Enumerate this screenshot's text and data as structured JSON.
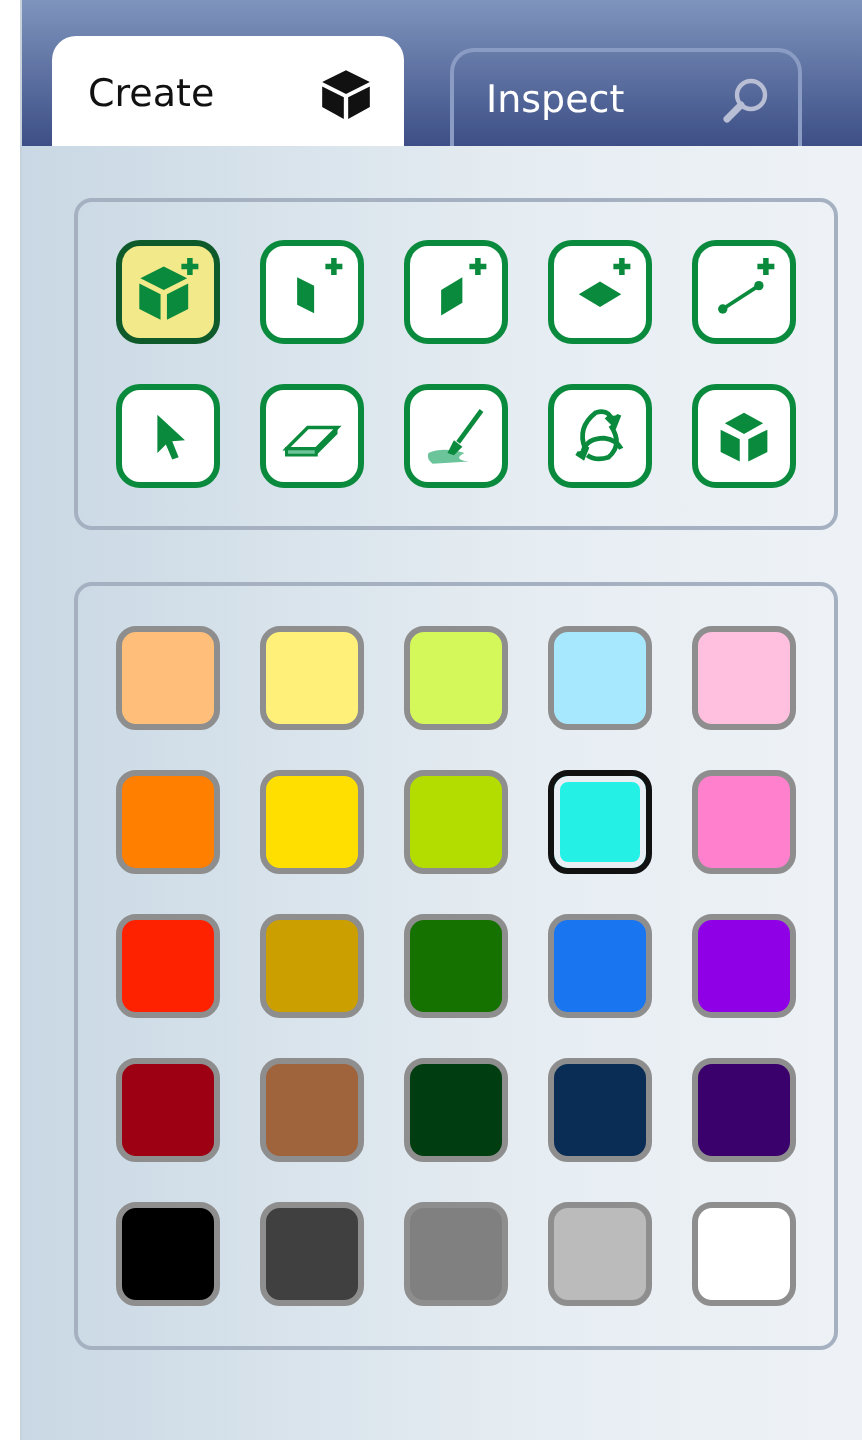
{
  "tabs": [
    {
      "label": "Create",
      "selected": true,
      "kind": "cube"
    },
    {
      "label": "Inspect",
      "selected": false,
      "kind": "search"
    }
  ],
  "tools": [
    {
      "kind": "solid",
      "selected": true
    },
    {
      "kind": "wall",
      "selected": false
    },
    {
      "kind": "slope",
      "selected": false
    },
    {
      "kind": "floor",
      "selected": false
    },
    {
      "kind": "edge",
      "selected": false
    },
    {
      "kind": "pointer",
      "selected": false
    },
    {
      "kind": "eraser",
      "selected": false
    },
    {
      "kind": "paint",
      "selected": false
    },
    {
      "kind": "rotate",
      "selected": false
    },
    {
      "kind": "box",
      "selected": false
    }
  ],
  "swatches": [
    {
      "color": "#ffbf7a",
      "selected": false
    },
    {
      "color": "#fff07a",
      "selected": false
    },
    {
      "color": "#d4f75a",
      "selected": false
    },
    {
      "color": "#a8e8ff",
      "selected": false
    },
    {
      "color": "#ffbfdf",
      "selected": false
    },
    {
      "color": "#ff7f00",
      "selected": false
    },
    {
      "color": "#ffdf00",
      "selected": false
    },
    {
      "color": "#b3dd00",
      "selected": false
    },
    {
      "color": "#25f0e6",
      "selected": true
    },
    {
      "color": "#ff80cc",
      "selected": false
    },
    {
      "color": "#ff2200",
      "selected": false
    },
    {
      "color": "#cc9f00",
      "selected": false
    },
    {
      "color": "#157200",
      "selected": false
    },
    {
      "color": "#1a75f0",
      "selected": false
    },
    {
      "color": "#9000e6",
      "selected": false
    },
    {
      "color": "#9c0012",
      "selected": false
    },
    {
      "color": "#a0643c",
      "selected": false
    },
    {
      "color": "#003d10",
      "selected": false
    },
    {
      "color": "#0a2d55",
      "selected": false
    },
    {
      "color": "#3a006b",
      "selected": false
    },
    {
      "color": "#000000",
      "selected": false
    },
    {
      "color": "#404040",
      "selected": false
    },
    {
      "color": "#808080",
      "selected": false
    },
    {
      "color": "#bbbbbb",
      "selected": false
    },
    {
      "color": "#ffffff",
      "selected": false
    }
  ]
}
